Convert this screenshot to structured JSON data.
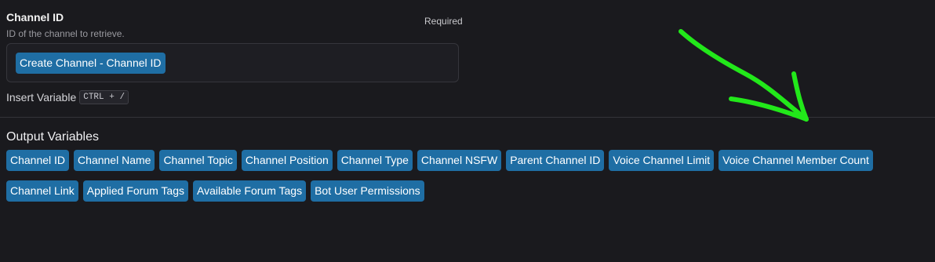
{
  "field": {
    "title": "Channel ID",
    "description": "ID of the channel to retrieve.",
    "required_label": "Required",
    "value_chip": "Create Channel - Channel ID"
  },
  "insert_variable": {
    "label": "Insert Variable",
    "shortcut": "CTRL + /"
  },
  "output": {
    "title": "Output Variables",
    "row1": [
      "Channel ID",
      "Channel Name",
      "Channel Topic",
      "Channel Position",
      "Channel Type",
      "Channel NSFW",
      "Parent Channel ID",
      "Voice Channel Limit",
      "Voice Channel Member Count"
    ],
    "row2": [
      "Channel Link",
      "Applied Forum Tags",
      "Available Forum Tags",
      "Bot User Permissions"
    ]
  },
  "annotation": {
    "color": "#22e81a",
    "icon": "hand-drawn-arrow-icon"
  },
  "colors": {
    "background": "#1a1a1e",
    "chip": "#1f6ea4"
  }
}
